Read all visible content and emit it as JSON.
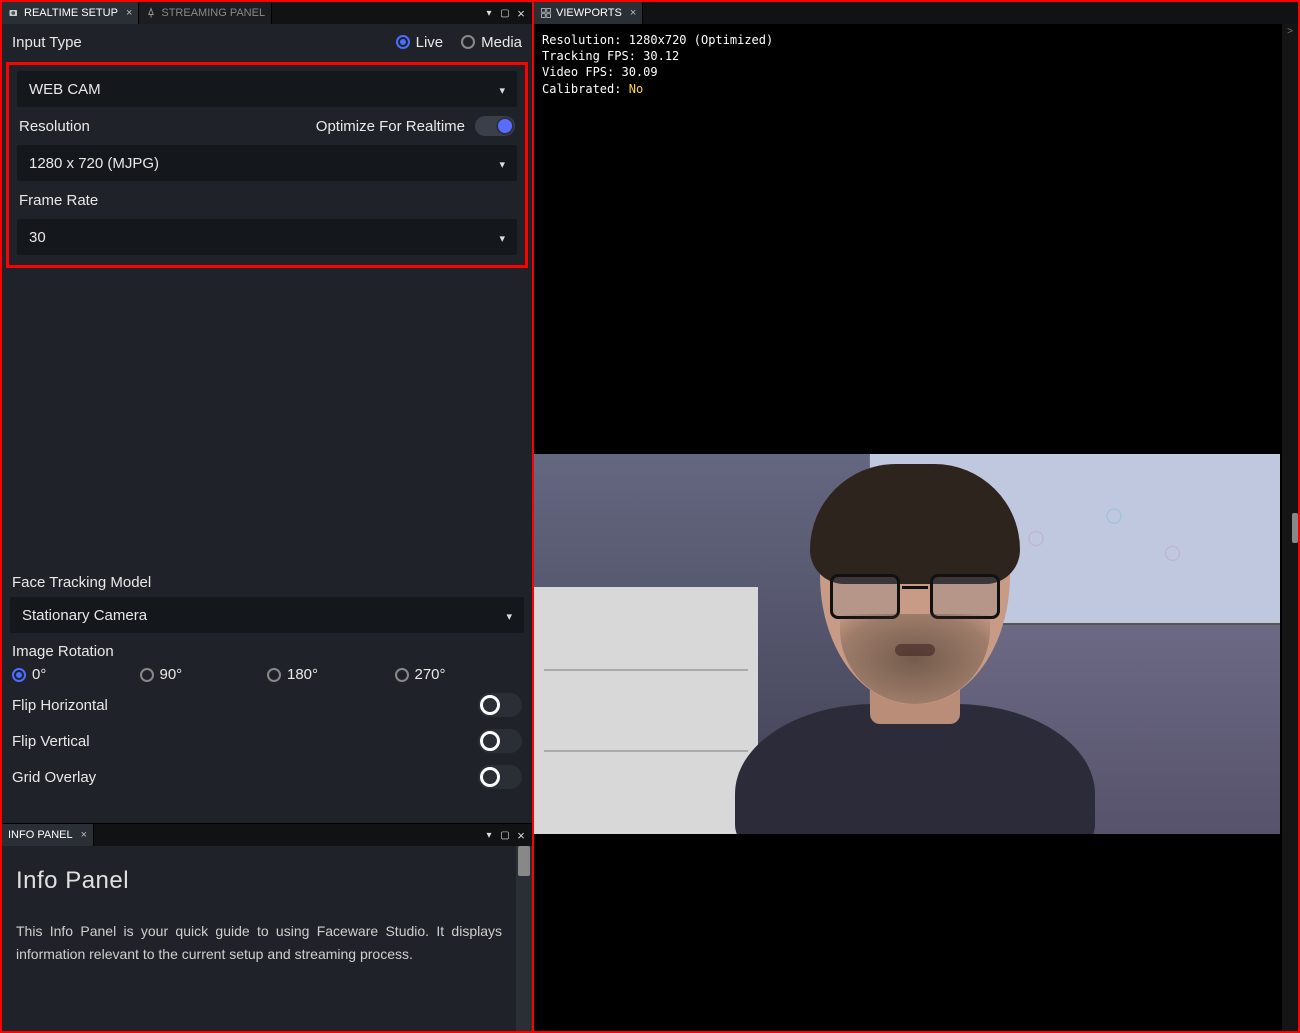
{
  "leftTabs": {
    "active": "REALTIME SETUP",
    "inactive": "STREAMING PANEL"
  },
  "rightTabs": {
    "active": "VIEWPORTS"
  },
  "setup": {
    "inputTypeLabel": "Input Type",
    "radioLive": "Live",
    "radioMedia": "Media",
    "webcamSelect": "WEB CAM",
    "resolutionLabel": "Resolution",
    "optimizeLabel": "Optimize For Realtime",
    "resolutionSelect": "1280 x 720 (MJPG)",
    "frameRateLabel": "Frame Rate",
    "frameRateSelect": "30",
    "trackingModelLabel": "Face Tracking Model",
    "trackingModelSelect": "Stationary Camera",
    "rotationLabel": "Image Rotation",
    "rot0": "0°",
    "rot90": "90°",
    "rot180": "180°",
    "rot270": "270°",
    "flipH": "Flip Horizontal",
    "flipV": "Flip Vertical",
    "gridOverlay": "Grid Overlay"
  },
  "infoPanel": {
    "tab": "INFO PANEL",
    "title": "Info Panel",
    "body": "This Info Panel is your quick guide to using Faceware Studio. It displays information relevant to the current setup and streaming process."
  },
  "viewport": {
    "resolutionLabel": "Resolution:",
    "resolutionValue": "1280x720 (Optimized)",
    "trackingLabel": "Tracking FPS:",
    "trackingValue": "30.12",
    "videoLabel": "Video FPS:",
    "videoValue": "30.09",
    "calibratedLabel": "Calibrated:",
    "calibratedValue": "No"
  }
}
